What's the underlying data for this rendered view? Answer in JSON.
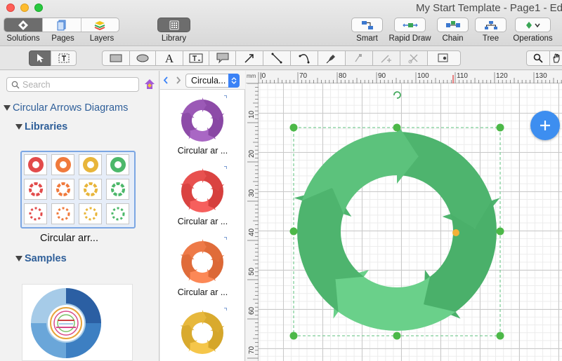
{
  "window": {
    "title": "My Start Template - Page1 - Ed"
  },
  "toolbar": {
    "solutions": "Solutions",
    "pages": "Pages",
    "layers": "Layers",
    "library": "Library",
    "smart": "Smart",
    "rapid_draw": "Rapid Draw",
    "chain": "Chain",
    "tree": "Tree",
    "operations": "Operations"
  },
  "search": {
    "placeholder": "Search"
  },
  "sidebar": {
    "solution_title": "Circular Arrows Diagrams",
    "libraries_label": "Libraries",
    "library_caption": "Circular arr...",
    "samples_label": "Samples"
  },
  "library_panel": {
    "selected": "Circula...",
    "items": [
      {
        "label": "Circular ar ...",
        "color": "#9b59b6"
      },
      {
        "label": "Circular ar ...",
        "color": "#e8514f"
      },
      {
        "label": "Circular ar ...",
        "color": "#ee7a48"
      },
      {
        "label": "",
        "color": "#e7b83c"
      }
    ]
  },
  "ruler": {
    "unit": "mm",
    "top_ticks": [
      "70",
      "80",
      "90",
      "100",
      "110",
      "120",
      "130"
    ],
    "left_ticks": [
      "10",
      "20",
      "30",
      "40",
      "50",
      "60",
      "70"
    ]
  },
  "colors": {
    "accent": "#3d8ef0",
    "diagram_green": "#5cc27c"
  }
}
